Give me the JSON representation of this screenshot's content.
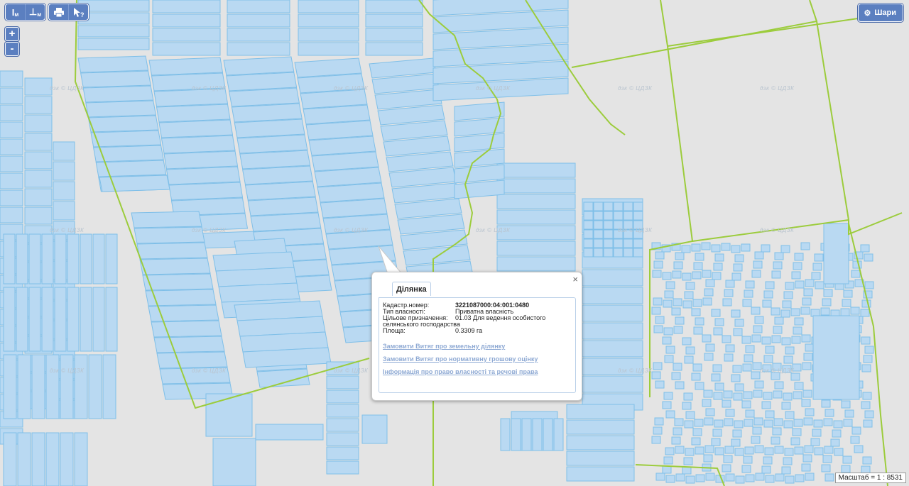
{
  "toolbar": {
    "ruler_label": "I",
    "ruler_unit": "м",
    "area_label": "⊥",
    "area_unit": "м",
    "print_icon": "print-icon",
    "info_icon": "pointer-question-icon"
  },
  "zoom": {
    "in_label": "+",
    "out_label": "-"
  },
  "layers": {
    "label": "Шари",
    "icon": "gear-icon"
  },
  "scale": {
    "text": "Масштаб = 1 : 8531"
  },
  "watermark": {
    "text": "дзк © ЦДЗК"
  },
  "popup": {
    "close_label": "×",
    "tab_label": "Ділянка",
    "fields": [
      {
        "label": "Кадастр.номер:",
        "value": "3221087000:04:001:0480",
        "bold": true
      },
      {
        "label": "Тип власності:",
        "value": "Приватна власність",
        "bold": false
      },
      {
        "label": "Цільове призначення:",
        "value": "01.03 Для ведення особистого селянського господарства",
        "bold": false
      },
      {
        "label": "Площа:",
        "value": "0.3309 га",
        "bold": false
      }
    ],
    "links": [
      "Замовити Витяг про земельну ділянку",
      "Замовити Витяг про нормативну грошову оцінку",
      "Інформація про право власності та речові права"
    ]
  },
  "colors": {
    "background": "#e4e4e4",
    "parcel_fill": "#b9d9f2",
    "parcel_stroke": "#7fbfe8",
    "boundary": "#9ccc3c",
    "button": "#5b7fc0"
  }
}
